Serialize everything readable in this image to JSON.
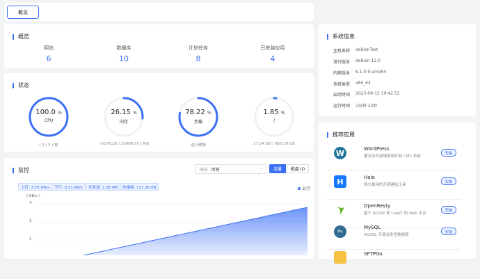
{
  "header": {
    "overview_button": "概览"
  },
  "overview": {
    "title": "概览",
    "items": [
      {
        "label": "网站",
        "value": "6"
      },
      {
        "label": "数据库",
        "value": "10"
      },
      {
        "label": "计划任务",
        "value": "8"
      },
      {
        "label": "已安装应用",
        "value": "4"
      }
    ]
  },
  "status": {
    "title": "状态",
    "gauges": [
      {
        "value": "100.0",
        "unit": "%",
        "label": "CPU",
        "info": "( 3 / 3 ) 核",
        "percent": 100
      },
      {
        "value": "26.15",
        "unit": "%",
        "label": "内存",
        "info": "( 6276.28 / 23998.55 ) MB",
        "percent": 26.15
      },
      {
        "value": "78.22",
        "unit": "%",
        "label": "负载",
        "info": "运行缓慢",
        "percent": 78.22
      },
      {
        "value": "1.85",
        "unit": "%",
        "label": "/",
        "info": "17.24 GB / 983.29 GB",
        "percent": 1.85
      }
    ]
  },
  "monitor": {
    "title": "监控",
    "nic_label": "网卡",
    "nic_value": "所有",
    "tab_traffic": "流量",
    "tab_disk": "磁盘 IO",
    "tags": [
      "上行: 3.72 KB/s",
      "下行: 0.21 KB/s",
      "总发送: 1.56 MB",
      "总接收: 127.16 KB"
    ],
    "legend_up": "上行",
    "y_unit": "( KB/s )",
    "y_ticks": [
      "4",
      "3",
      "2"
    ]
  },
  "sysinfo": {
    "title": "系统信息",
    "rows": [
      {
        "k": "主机名称",
        "v": "debianTest"
      },
      {
        "k": "发行版本",
        "v": "debian-12.0"
      },
      {
        "k": "内核版本",
        "v": "6.1.0-9-amd64"
      },
      {
        "k": "系统类型",
        "v": "x86_64"
      },
      {
        "k": "启动时间",
        "v": "2023-09-12 19:42:52"
      },
      {
        "k": "运行时间",
        "v": "2分钟 22秒"
      }
    ]
  },
  "apps": {
    "title": "推荐应用",
    "install_label": "安装",
    "items": [
      {
        "name": "WordPress",
        "desc": "著名的开源博客软件和 CMS 系统"
      },
      {
        "name": "Halo",
        "desc": "强大易用的开源建站工具"
      },
      {
        "name": "OpenResty",
        "desc": "基于 NGINX 和 LuaJIT 的 Web 平台"
      },
      {
        "name": "MySQL",
        "desc": "MySQL 开源关系型数据库"
      },
      {
        "name": "SFTPGo",
        "desc": ""
      }
    ]
  },
  "colors": {
    "accent": "#3b6ff5"
  }
}
